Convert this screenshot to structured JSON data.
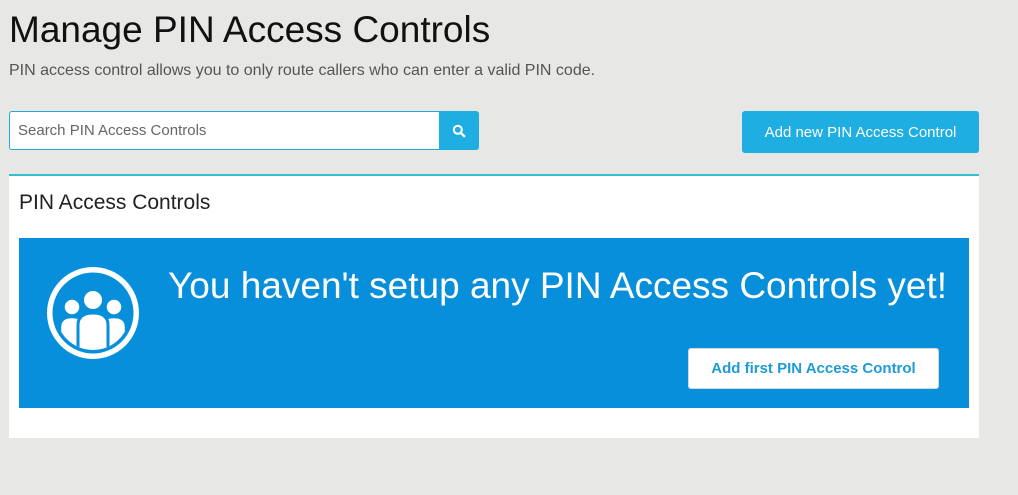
{
  "header": {
    "title": "Manage PIN Access Controls",
    "subtitle": "PIN access control allows you to only route callers who can enter a valid PIN code."
  },
  "search": {
    "placeholder": "Search PIN Access Controls",
    "value": "",
    "button_icon": "search-icon"
  },
  "toolbar": {
    "add_new_label": "Add new PIN Access Control"
  },
  "panel": {
    "title": "PIN Access Controls",
    "empty_state": {
      "icon": "users-group-icon",
      "message": "You haven't setup any PIN Access Controls yet!",
      "button_label": "Add first PIN Access Control"
    }
  },
  "colors": {
    "background": "#e7e7e6",
    "accent": "#1eaee2",
    "banner": "#078fdb",
    "panel_border": "#33bfcc",
    "link_text": "#1c9bd6"
  }
}
